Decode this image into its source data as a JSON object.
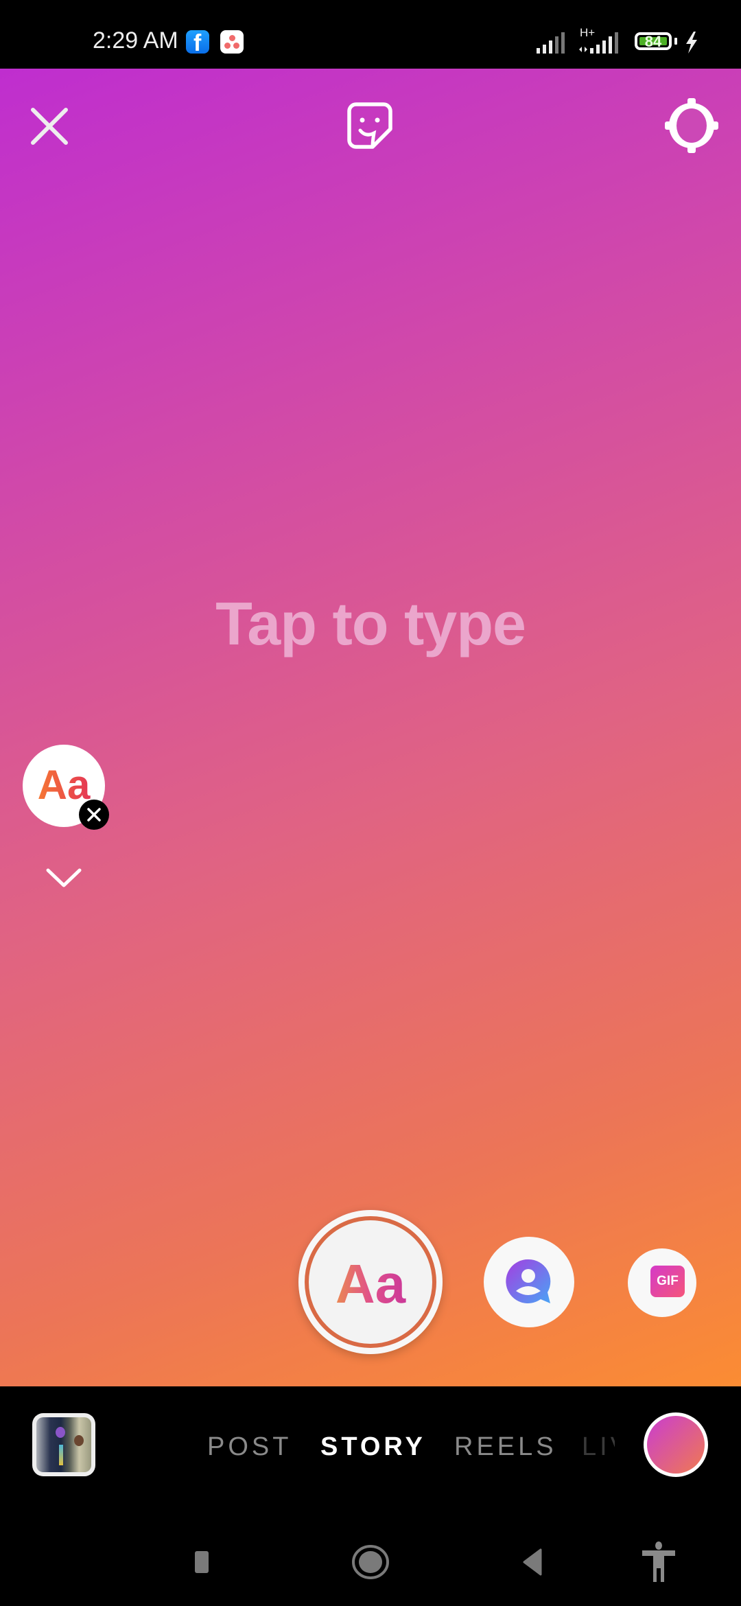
{
  "status_bar": {
    "time": "2:29 AM",
    "notification_icons": [
      "facebook-icon",
      "asana-icon"
    ],
    "network_type": "H+",
    "battery_level": "84",
    "charging": true
  },
  "top_toolbar": {
    "close_icon": "close-icon",
    "sticker_icon": "sticker-icon",
    "settings_icon": "settings-icon"
  },
  "canvas": {
    "placeholder": "Tap to type",
    "gradient_colors": [
      "#bf2ecf",
      "#d24ba6",
      "#e06383",
      "#ec7557",
      "#fb8c33"
    ]
  },
  "font_bubble": {
    "label": "Aa",
    "remove_icon": "close-icon",
    "expand_icon": "chevron-down-icon"
  },
  "create_modes": {
    "selected": {
      "label": "Aa",
      "name": "text-mode"
    },
    "options": [
      {
        "name": "mention-mode",
        "icon": "mention-icon"
      },
      {
        "name": "gif-mode",
        "label": "GIF"
      }
    ]
  },
  "bottom_bar": {
    "tabs": [
      {
        "label": "POST",
        "active": false
      },
      {
        "label": "STORY",
        "active": true
      },
      {
        "label": "REELS",
        "active": false
      },
      {
        "label": "LIVE",
        "active": false
      }
    ]
  },
  "system_nav": [
    "recents-icon",
    "home-icon",
    "back-icon",
    "accessibility-icon"
  ]
}
